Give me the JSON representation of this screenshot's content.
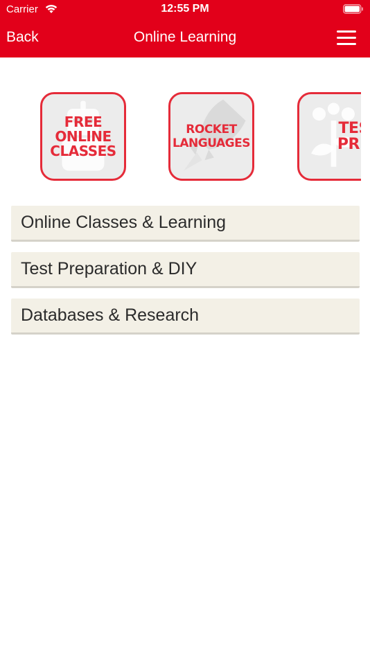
{
  "status_bar": {
    "carrier": "Carrier",
    "time": "12:55 PM"
  },
  "navbar": {
    "back_label": "Back",
    "title": "Online Learning",
    "menu_icon": "hamburger-menu-icon"
  },
  "tiles": [
    {
      "line1": "FREE",
      "line2": "ONLINE",
      "line3": "CLASSES",
      "icon": "robot-background-icon"
    },
    {
      "line1": "ROCKET",
      "line2": "LANGUAGES",
      "icon": "rocket-background-icon"
    },
    {
      "line1": "TEST",
      "line2": "PREP",
      "icon": "flower-background-icon"
    }
  ],
  "menu_items": [
    {
      "label": "Online Classes & Learning"
    },
    {
      "label": "Test Preparation & DIY"
    },
    {
      "label": "Databases & Research"
    }
  ],
  "colors": {
    "brand_red": "#e2001a",
    "tile_red": "#e52b39",
    "list_bg": "#f3f0e6"
  }
}
